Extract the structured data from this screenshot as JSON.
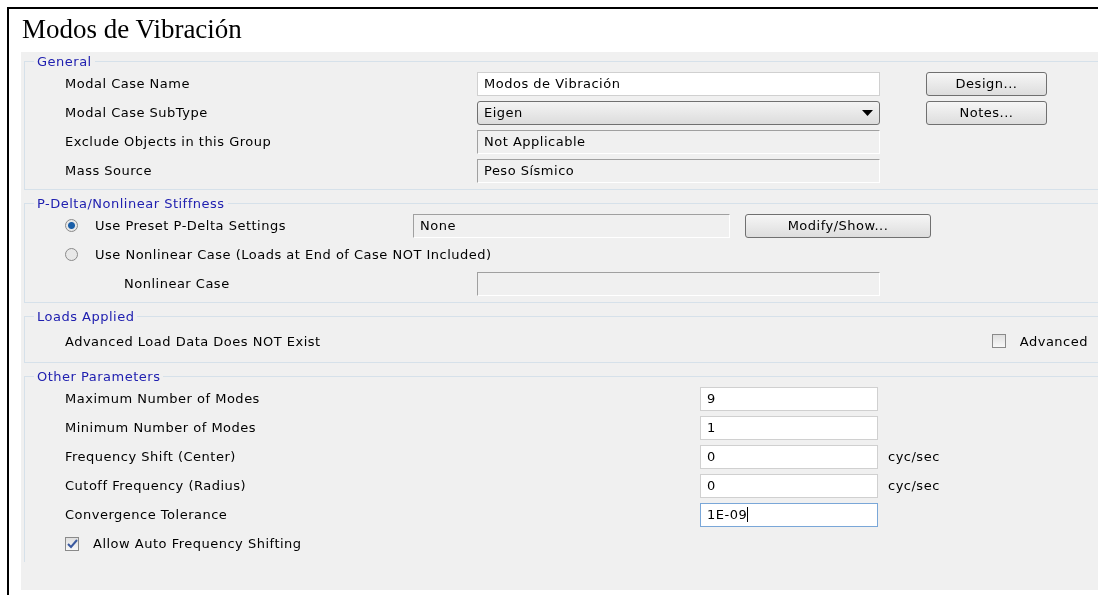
{
  "title": "Modos de Vibración",
  "general": {
    "legend": "General",
    "fields": [
      {
        "label": "Modal Case Name",
        "value": "Modos de Vibración",
        "kind": "input"
      },
      {
        "label": "Modal Case SubType",
        "value": "Eigen",
        "kind": "dropdown"
      },
      {
        "label": "Exclude Objects in this Group",
        "value": "Not Applicable",
        "kind": "readonly"
      },
      {
        "label": "Mass Source",
        "value": "Peso Sísmico",
        "kind": "readonly"
      }
    ],
    "buttons": [
      "Design...",
      "Notes..."
    ]
  },
  "pdelta": {
    "legend": "P-Delta/Nonlinear Stiffness",
    "options": [
      {
        "label": "Use Preset P-Delta Settings",
        "selected": true,
        "value": "None",
        "button": "Modify/Show..."
      },
      {
        "label": "Use Nonlinear Case  (Loads at End of Case NOT Included)",
        "selected": false
      }
    ],
    "nonlinear_case": {
      "label": "Nonlinear Case"
    }
  },
  "loads": {
    "legend": "Loads Applied",
    "message": "Advanced Load Data Does NOT Exist",
    "advanced": {
      "label": "Advanced",
      "checked": false
    }
  },
  "other": {
    "legend": "Other Parameters",
    "fields": [
      {
        "label": "Maximum Number of Modes",
        "value": "9",
        "focused": false
      },
      {
        "label": "Minimum Number of Modes",
        "value": "1",
        "focused": false
      },
      {
        "label": "Frequency Shift  (Center)",
        "value": "0",
        "unit": "cyc/sec",
        "focused": false
      },
      {
        "label": "Cutoff Frequency  (Radius)",
        "value": "0",
        "unit": "cyc/sec",
        "focused": false
      },
      {
        "label": "Convergence Tolerance",
        "value": "1E-09",
        "focused": true
      }
    ],
    "auto_shift": {
      "label": "Allow Auto Frequency Shifting",
      "checked": true
    }
  }
}
